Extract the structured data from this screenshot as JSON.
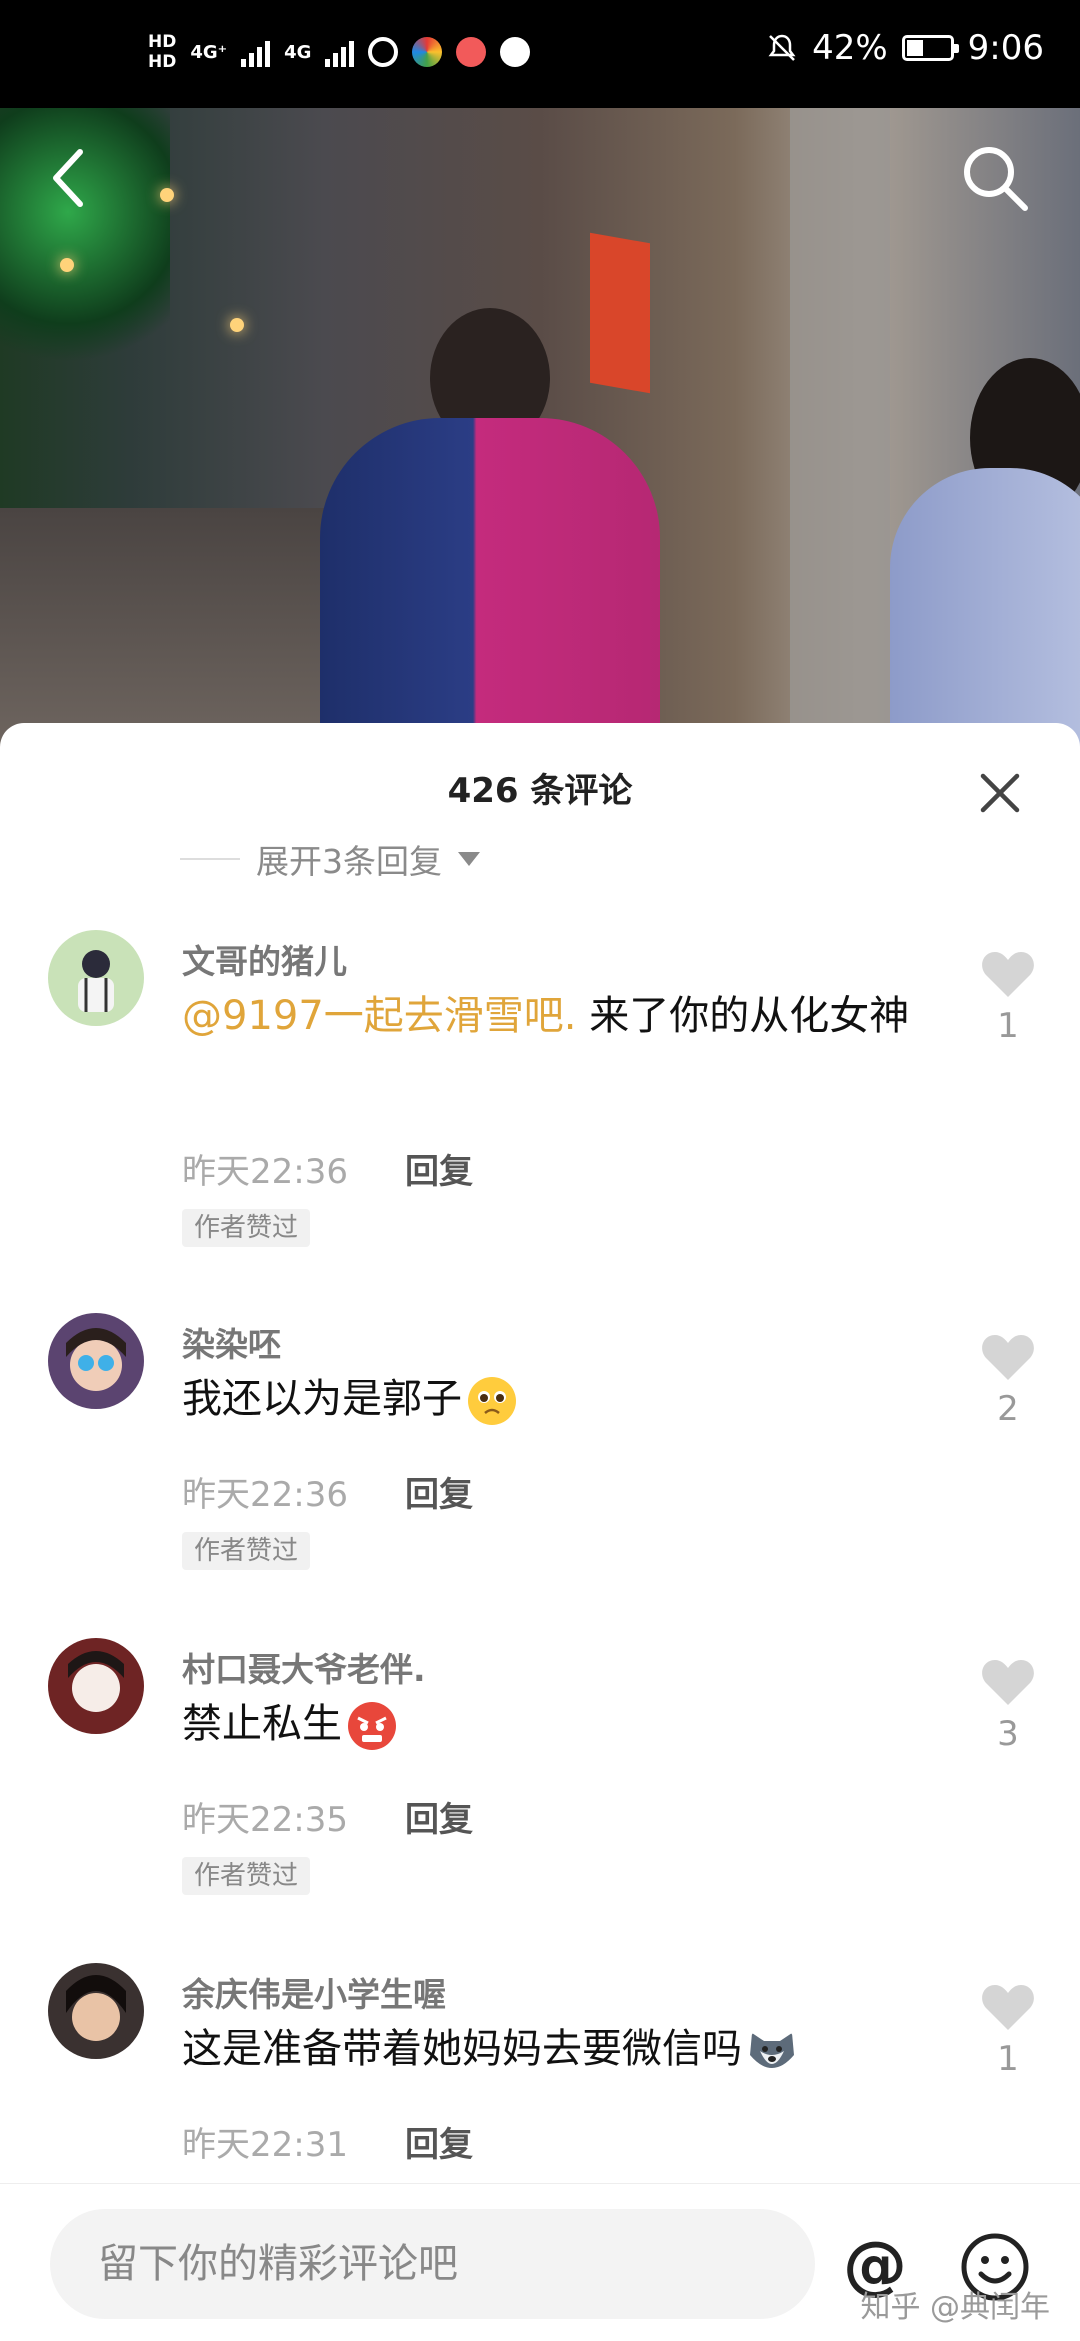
{
  "status_bar": {
    "hd1": "HD",
    "hd2": "HD",
    "net1": "4G⁺",
    "net2": "4G",
    "battery_percent": "42%",
    "battery_level": 0.42,
    "time": "9:06"
  },
  "video": {
    "back_icon": "chevron-left-icon",
    "search_icon": "search-icon"
  },
  "sheet": {
    "title": "426 条评论",
    "expand_replies": "展开3条回复",
    "close_icon": "close-icon"
  },
  "comments": [
    {
      "name": "文哥的猪儿",
      "mention": "@9197一起去滑雪吧.",
      "text": " 来了你的从化女神",
      "time": "昨天22:36",
      "reply": "回复",
      "tag": "作者赞过",
      "likes": "1",
      "avatar_color": "#b7d6a8"
    },
    {
      "name": "染染呸",
      "text": "我还以为是郭子",
      "emoji": "pleading-face",
      "time": "昨天22:36",
      "reply": "回复",
      "tag": "作者赞过",
      "likes": "2",
      "avatar_color": "#6a4c7a"
    },
    {
      "name": "村口聂大爷老伴.",
      "text": "禁止私生",
      "emoji": "angry-face",
      "time": "昨天22:35",
      "reply": "回复",
      "tag": "作者赞过",
      "likes": "3",
      "avatar_color": "#7a2d2d"
    },
    {
      "name": "余庆伟是小学生喔",
      "text": "这是准备带着她妈妈去要微信吗",
      "emoji": "husky-face",
      "time": "昨天22:31",
      "reply": "回复",
      "likes": "1",
      "avatar_color": "#3a3130"
    }
  ],
  "bottom_bar": {
    "placeholder": "留下你的精彩评论吧",
    "at_symbol": "@",
    "watermark": "知乎 @典闰年"
  }
}
